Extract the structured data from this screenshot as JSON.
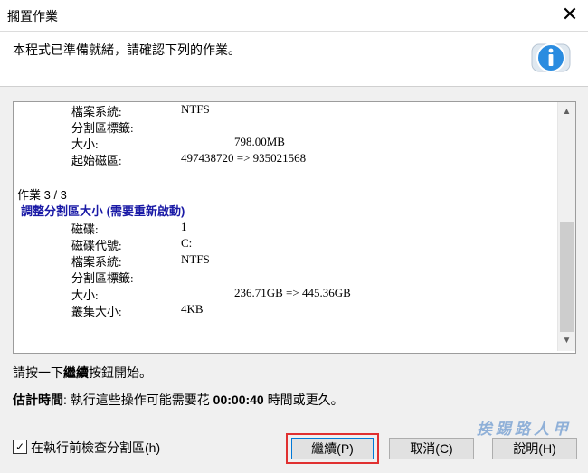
{
  "window": {
    "title": "擱置作業",
    "close_glyph": "✕"
  },
  "header": {
    "message": "本程式已準備就緒，請確認下列的作業。"
  },
  "operations": {
    "partial_rows": [
      {
        "key": "檔案系統:",
        "value": "NTFS",
        "col": "v1"
      },
      {
        "key": "分割區標籤:",
        "value": "",
        "col": "v1"
      },
      {
        "key": "大小:",
        "value": "798.00MB",
        "col": "v2"
      },
      {
        "key": "起始磁區:",
        "value": "497438720 => 935021568",
        "col": "v1"
      }
    ],
    "op3": {
      "heading": "作業 3 / 3",
      "title": "調整分割區大小 (需要重新啟動)",
      "rows": [
        {
          "key": "磁碟:",
          "value": "1",
          "col": "v1"
        },
        {
          "key": "磁碟代號:",
          "value": "C:",
          "col": "v1"
        },
        {
          "key": "檔案系統:",
          "value": "NTFS",
          "col": "v1"
        },
        {
          "key": "分割區標籤:",
          "value": "",
          "col": "v1"
        },
        {
          "key": "大小:",
          "value": "236.71GB => 445.36GB",
          "col": "v2"
        },
        {
          "key": "叢集大小:",
          "value": "4KB",
          "col": "v1"
        }
      ]
    }
  },
  "prompt": {
    "before": "請按一下",
    "bold": "繼續",
    "after": "按鈕開始。"
  },
  "estimate": {
    "label": "估計時間",
    "middle": ": 執行這些操作可能需要花 ",
    "time": "00:00:40",
    "after": " 時間或更久。"
  },
  "watermark": "挨踢路人甲",
  "check_partition": {
    "label": "在執行前檢查分割區(h)",
    "checked": true,
    "mark": "✓"
  },
  "buttons": {
    "continue": "繼續(P)",
    "cancel": "取消(C)",
    "help": "說明(H)"
  },
  "icons": {
    "info": "info-icon",
    "scroll_up": "▲",
    "scroll_down": "▼"
  }
}
